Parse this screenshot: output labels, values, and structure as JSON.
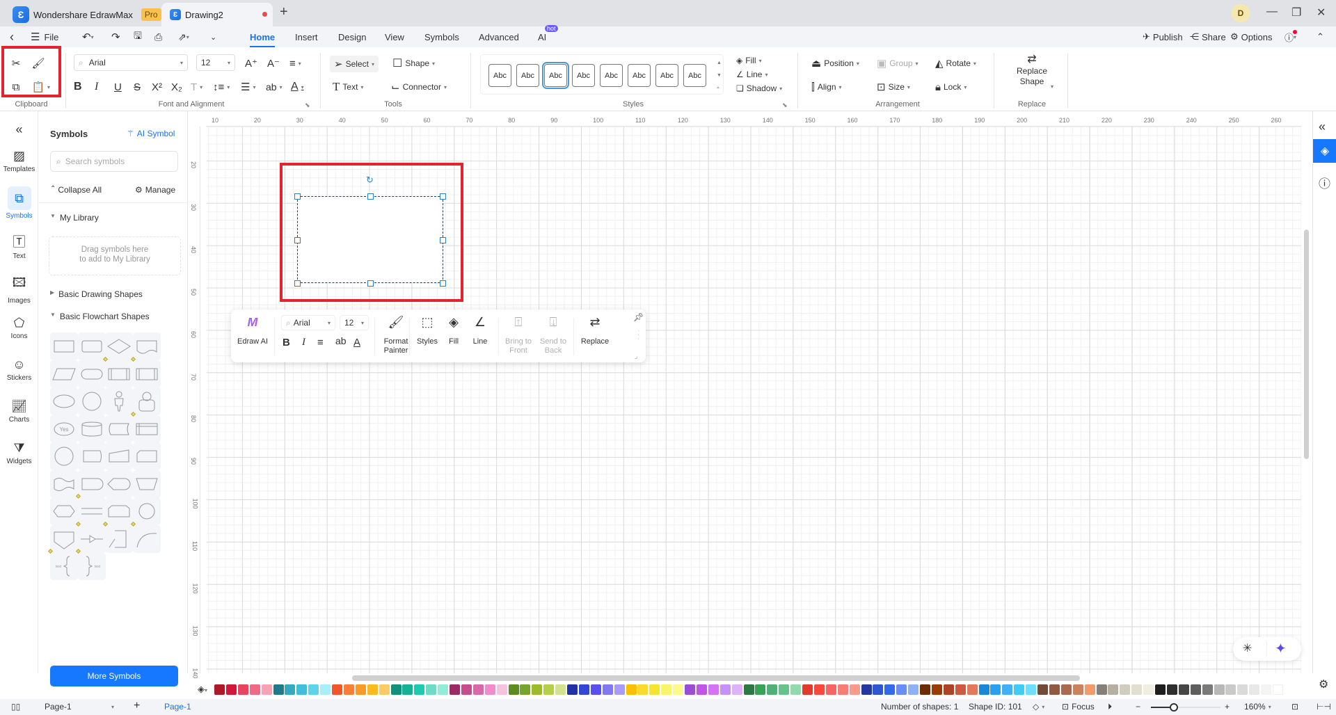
{
  "titlebar": {
    "app_name": "Wondershare EdrawMax",
    "app_badge": "Pro",
    "doc_tab": "Drawing2",
    "user_initial": "D"
  },
  "menubar": {
    "file": "File",
    "tabs": [
      "Home",
      "Insert",
      "Design",
      "View",
      "Symbols",
      "Advanced",
      "AI"
    ],
    "active_tab": "Home",
    "ai_badge": "hot",
    "publish": "Publish",
    "share": "Share",
    "options": "Options"
  },
  "ribbon": {
    "clipboard_label": "Clipboard",
    "font_label": "Font and Alignment",
    "font_name": "Arial",
    "font_size": "12",
    "tools_label": "Tools",
    "tools": {
      "select": "Select",
      "shape": "Shape",
      "text": "Text",
      "connector": "Connector"
    },
    "styles_label": "Styles",
    "style_swatches": [
      "Abc",
      "Abc",
      "Abc",
      "Abc",
      "Abc",
      "Abc",
      "Abc",
      "Abc"
    ],
    "fill": "Fill",
    "line": "Line",
    "shadow": "Shadow",
    "arrangement_label": "Arrangement",
    "arrangement": {
      "position": "Position",
      "group": "Group",
      "rotate": "Rotate",
      "align": "Align",
      "size": "Size",
      "lock": "Lock"
    },
    "replace_label": "Replace",
    "replace_shape": "Replace Shape"
  },
  "rail": {
    "items": [
      {
        "label": "Templates",
        "icon": "templates-icon"
      },
      {
        "label": "Symbols",
        "icon": "symbols-icon"
      },
      {
        "label": "Text",
        "icon": "text-icon"
      },
      {
        "label": "Images",
        "icon": "images-icon"
      },
      {
        "label": "Icons",
        "icon": "icons-icon"
      },
      {
        "label": "Stickers",
        "icon": "stickers-icon"
      },
      {
        "label": "Charts",
        "icon": "charts-icon"
      },
      {
        "label": "Widgets",
        "icon": "widgets-icon"
      }
    ]
  },
  "panel": {
    "title": "Symbols",
    "ai_symbol": "AI Symbol",
    "search_placeholder": "Search symbols",
    "collapse_all": "Collapse All",
    "manage": "Manage",
    "my_library": "My Library",
    "drop_hint_1": "Drag symbols here",
    "drop_hint_2": "to add to My Library",
    "basic_drawing": "Basic Drawing Shapes",
    "basic_flowchart": "Basic Flowchart Shapes",
    "more_symbols": "More Symbols"
  },
  "rulers": {
    "h": [
      "10",
      "20",
      "30",
      "40",
      "50",
      "60",
      "70",
      "80",
      "90",
      "100",
      "110",
      "120",
      "130",
      "140",
      "150",
      "160",
      "170",
      "180",
      "190",
      "200",
      "210",
      "220",
      "230",
      "240",
      "250",
      "260"
    ],
    "v": [
      "20",
      "30",
      "40",
      "50",
      "60",
      "70",
      "80",
      "90",
      "100",
      "110",
      "120",
      "130",
      "140"
    ]
  },
  "floating_toolbar": {
    "edraw_ai": "Edraw AI",
    "font_name": "Arial",
    "font_size": "12",
    "format_painter": "Format Painter",
    "styles": "Styles",
    "fill": "Fill",
    "line": "Line",
    "bring_to_front": "Bring to Front",
    "send_to_back": "Send to Back",
    "replace": "Replace"
  },
  "palette": [
    "#b0182a",
    "#d3173a",
    "#e8445f",
    "#f06a86",
    "#f5a3b5",
    "#217a8a",
    "#34a9c3",
    "#3fbfdc",
    "#5dd3ec",
    "#a9eefa",
    "#f2562a",
    "#fb7d36",
    "#fb9a26",
    "#fbbb1e",
    "#fbcb66",
    "#12917a",
    "#16b294",
    "#1dcbb0",
    "#6ddbc6",
    "#93ecd9",
    "#9a2b63",
    "#c64c8c",
    "#d96aa7",
    "#f08bcd",
    "#f5c3de",
    "#5c8c1f",
    "#76a52a",
    "#9cbb2a",
    "#b5cf47",
    "#d4e290",
    "#2331a8",
    "#3346d8",
    "#5a4ff0",
    "#8278ef",
    "#a99bf7",
    "#fbc100",
    "#fcd92a",
    "#f6e52e",
    "#fbf56a",
    "#fcfa8c",
    "#9a4ed8",
    "#c255e8",
    "#d673f4",
    "#c692f8",
    "#dfb1fb",
    "#2c7a43",
    "#37a357",
    "#4fb176",
    "#67c28b",
    "#94d9ae",
    "#e33a2c",
    "#f9493f",
    "#f86461",
    "#fa7a74",
    "#fb9a8c",
    "#2339a0",
    "#2f57d0",
    "#3369ef",
    "#6a8ef7",
    "#8fb1f3",
    "#6d2b06",
    "#9b3c06",
    "#ae4425",
    "#cf5a3d",
    "#e3785a",
    "#1787d9",
    "#2b9ff0",
    "#41b1f7",
    "#3ecdf8",
    "#6ddefb",
    "#734a35",
    "#925a42",
    "#ab6a50",
    "#cb835e",
    "#f39a6c",
    "#86807a",
    "#b5b0a2",
    "#d0cdbd",
    "#e3dfd0",
    "#f1eedf",
    "#1e1e1e",
    "#2f2f2f",
    "#474747",
    "#5f5f5f",
    "#7b7b7b",
    "#b8b8b8",
    "#cacaca",
    "#dadada",
    "#e8e8e8",
    "#f4f4f4",
    "#ffffff"
  ],
  "status": {
    "page_select": "Page-1",
    "page_tab": "Page-1",
    "num_shapes": "Number of shapes: 1",
    "shape_id": "Shape ID: 101",
    "focus": "Focus",
    "zoom": "160%",
    "zoom_fraction": 0.33
  }
}
